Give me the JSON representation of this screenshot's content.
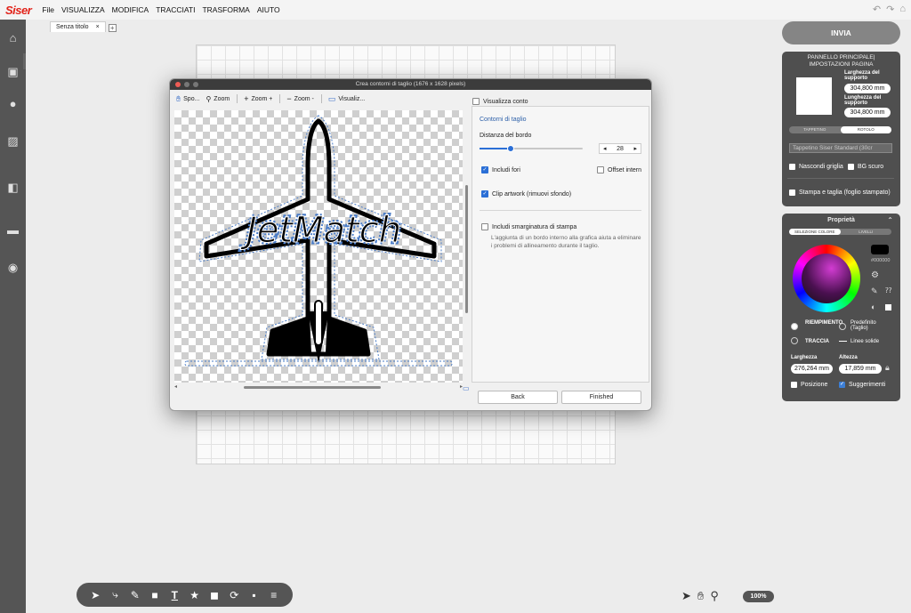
{
  "menubar": {
    "logo": "Siser",
    "items": [
      "File",
      "VISUALIZZA",
      "MODIFICA",
      "TRACCIATI",
      "TRASFORMA",
      "AIUTO"
    ]
  },
  "tabs": {
    "document": "Senza titolo",
    "close": "×",
    "add": "+"
  },
  "right_panel": {
    "send_label": "INVIA",
    "main_panel_title": "PANNELLO PRINCIPALE| IMPOSTAZIONI PAGINA",
    "width_label": "Larghezza del supporto",
    "width_value": "304,800 mm",
    "length_label": "Lunghezza del supporto",
    "length_value": "304,800 mm",
    "seg_tappetino": "TAPPETINO",
    "seg_rotolo": "ROTOLO",
    "mat_dropdown": "Tappetino Siser Standard (30cr",
    "hide_grid": "Nascondi griglia",
    "bg_dark": "BG scuro",
    "print_cut": "Stampa e taglia (foglio stampato)"
  },
  "properties_panel": {
    "title": "Proprietà",
    "tab_color": "SELEZIONE COLORE",
    "tab_layers": "LIVELLI",
    "hex": "#000000",
    "fill_label": "RIEMPIMENTO",
    "default_label": "Predefinito (Taglio)",
    "stroke_label": "TRACCIA",
    "line_label": "Linee solide",
    "width_label": "Larghezza",
    "width_value": "276,264 mm",
    "height_label": "Altezza",
    "height_value": "17,859 mm",
    "position_label": "Posizione",
    "suggestions_label": "Suggerimenti"
  },
  "dialog": {
    "title": "Crea contorni di taglio  (1676 x 1628 pixels)",
    "tools": {
      "pan": "Spo...",
      "zoom": "Zoom",
      "zoom_in": "Zoom +",
      "zoom_out": "Zoom -",
      "visualize": "Visualiz..."
    },
    "show_contour": "Visualizza conto",
    "section_title": "Contorni di taglio",
    "border_distance_label": "Distanza del bordo",
    "border_distance_value": "28",
    "border_distance_fraction": 0.3,
    "include_holes": "Includi fori",
    "offset_internal": "Offset intern",
    "clip_artwork": "Clip artwork (rimuovi sfondo)",
    "include_bleed": "Includi smarginatura di stampa",
    "bleed_help": "L'aggiunta di un bordo interno alla grafica aiuta a eliminare i problemi di allineamento durante il taglio.",
    "back": "Back",
    "finished": "Finished",
    "artwork_text": "JetMatch"
  },
  "bottom_zoom": "100%"
}
